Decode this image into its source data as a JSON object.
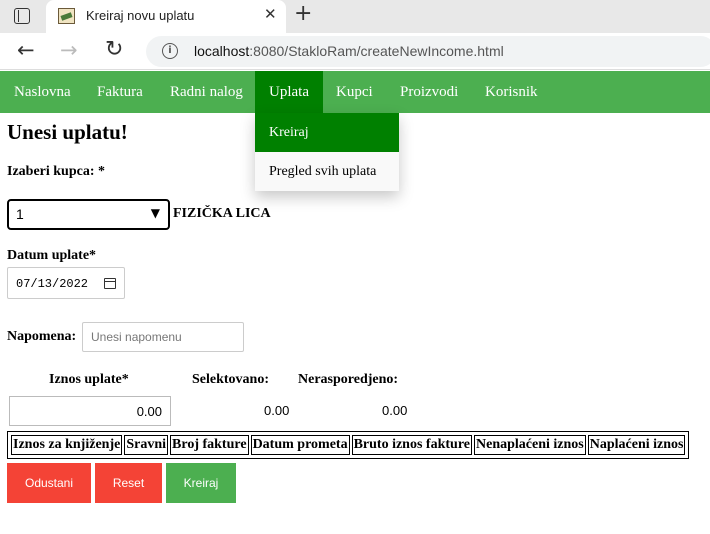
{
  "browser": {
    "tab_title": "Kreiraj novu uplatu",
    "close_glyph": "✕",
    "new_tab_glyph": "+",
    "back_glyph": "←",
    "forward_glyph": "→",
    "reload_glyph": "↻",
    "info_glyph": "i",
    "url_host": "localhost",
    "url_rest": ":8080/StakloRam/createNewIncome.html"
  },
  "nav": {
    "items": [
      "Naslovna",
      "Faktura",
      "Radni nalog",
      "Uplata",
      "Kupci",
      "Proizvodi",
      "Korisnik"
    ],
    "active": "Uplata",
    "dropdown": [
      "Kreiraj",
      "Pregled svih uplata"
    ]
  },
  "form": {
    "title": "Unesi uplatu!",
    "customer_label": "Izaberi kupca: *",
    "customer_value": "1",
    "customer_caret": "▼",
    "customer_type": "FIZIČKA LICA",
    "date_label": "Datum uplate*",
    "date_value": "07/13/2022",
    "note_label": "Napomena:",
    "note_placeholder": "Unesi napomenu",
    "amount_label": "Iznos uplate*",
    "amount_value": "0.00",
    "selected_label": "Selektovano:",
    "selected_value": "0.00",
    "unallocated_label": "Nerasporedjeno:",
    "unallocated_value": "0.00"
  },
  "table": {
    "headers": [
      "Iznos za knjiženje",
      "Sravni",
      "Broj fakture",
      "Datum prometa",
      "Bruto iznos fakture",
      "Nenaplaćeni iznos",
      "Naplaćeni iznos"
    ]
  },
  "buttons": {
    "cancel": "Odustani",
    "reset": "Reset",
    "create": "Kreiraj"
  },
  "colors": {
    "nav_bg": "#4caf50",
    "nav_active": "#008000",
    "danger": "#f44336",
    "success": "#4caf50"
  }
}
